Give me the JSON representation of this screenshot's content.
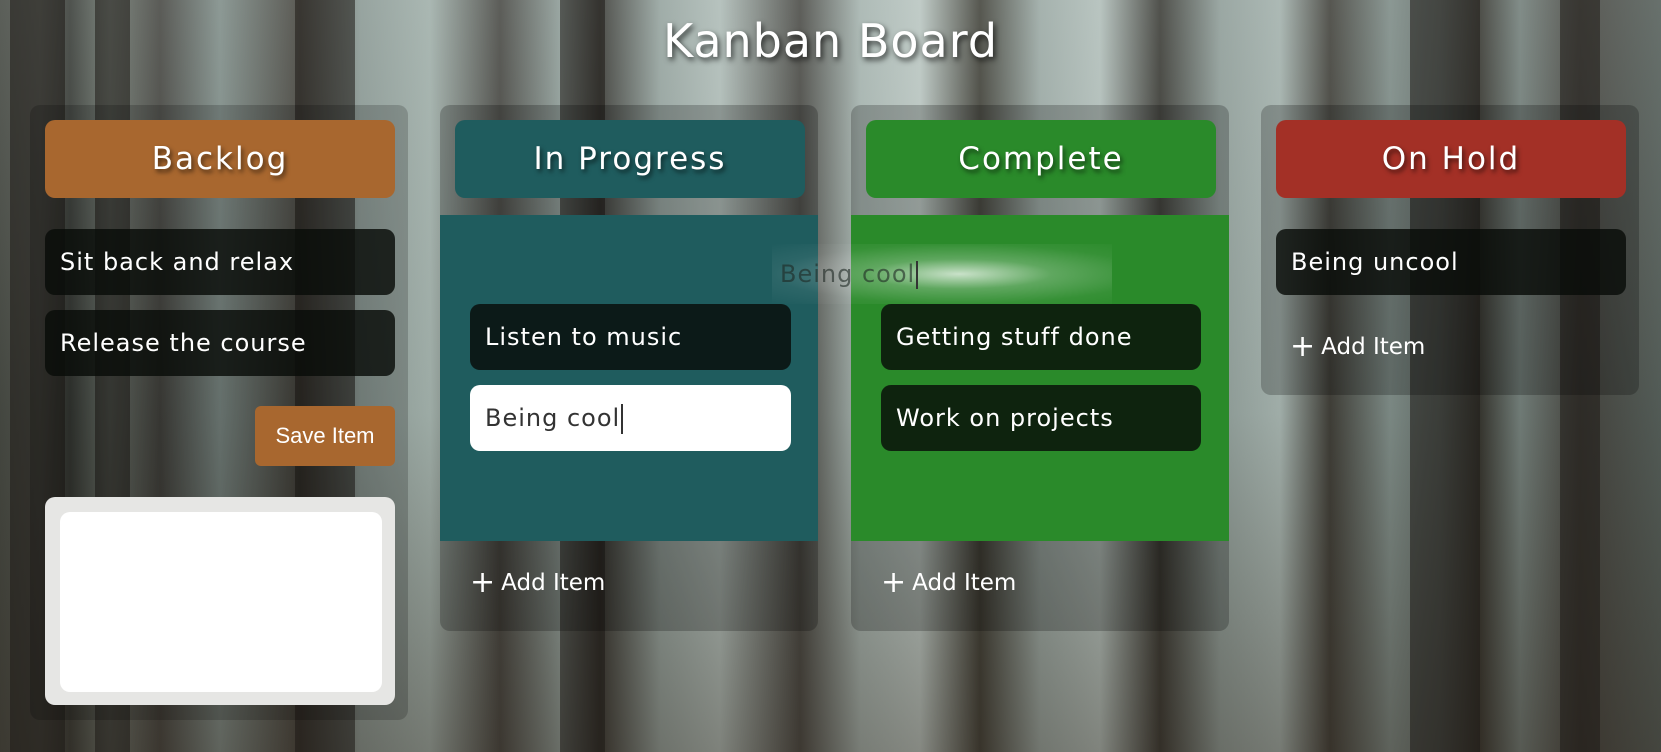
{
  "board": {
    "title": "Kanban Board"
  },
  "columns": [
    {
      "id": "backlog",
      "title": "Backlog",
      "color": "#a8672f",
      "items": [
        "Sit back and relax",
        "Release the course"
      ],
      "save_label": "Save Item"
    },
    {
      "id": "in-progress",
      "title": "In Progress",
      "color": "#1f5c5e",
      "items": [
        "Listen to music"
      ],
      "editing_value": "Being cool",
      "add_label": "Add Item"
    },
    {
      "id": "complete",
      "title": "Complete",
      "color": "#2a8a2a",
      "items": [
        "Getting stuff done",
        "Work on projects"
      ],
      "add_label": "Add Item"
    },
    {
      "id": "on-hold",
      "title": "On Hold",
      "color": "#a33026",
      "items": [
        "Being uncool"
      ],
      "add_label": "Add Item"
    }
  ],
  "drag_ghost": {
    "text": "Being cool"
  },
  "icons": {
    "add": "plus-icon"
  }
}
